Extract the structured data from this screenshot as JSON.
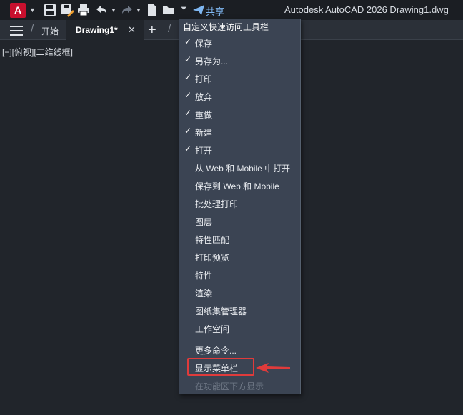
{
  "titlebar": {
    "app_letter": "A",
    "share_label": "共享",
    "title": "Autodesk AutoCAD 2026    Drawing1.dwg",
    "qat_icons": [
      "save-icon",
      "save-as-icon",
      "print-icon",
      "undo-icon",
      "redo-icon",
      "new-icon",
      "open-icon",
      "customize-dropdown-icon",
      "share-icon"
    ]
  },
  "tabs": {
    "start": "开始",
    "active": "Drawing1*",
    "close": "✕",
    "add": "+"
  },
  "viewport": {
    "label": "[−][俯视][二维线框]"
  },
  "menu": {
    "title": "自定义快速访问工具栏",
    "items": [
      {
        "label": "保存",
        "checked": true
      },
      {
        "label": "另存为...",
        "checked": true
      },
      {
        "label": "打印",
        "checked": true
      },
      {
        "label": "放弃",
        "checked": true
      },
      {
        "label": "重做",
        "checked": true
      },
      {
        "label": "新建",
        "checked": true
      },
      {
        "label": "打开",
        "checked": true
      },
      {
        "label": "从 Web 和 Mobile 中打开",
        "checked": false
      },
      {
        "label": "保存到 Web 和 Mobile",
        "checked": false
      },
      {
        "label": "批处理打印",
        "checked": false
      },
      {
        "label": "图层",
        "checked": false
      },
      {
        "label": "特性匹配",
        "checked": false
      },
      {
        "label": "打印预览",
        "checked": false
      },
      {
        "label": "特性",
        "checked": false
      },
      {
        "label": "渲染",
        "checked": false
      },
      {
        "label": "图纸集管理器",
        "checked": false
      },
      {
        "label": "工作空间",
        "checked": false
      }
    ],
    "more": "更多命令...",
    "show_menubar": "显示菜单栏",
    "show_below_ribbon": "在功能区下方显示"
  },
  "colors": {
    "accent": "#c8102e",
    "highlight": "#e03b3b",
    "share": "#7fb7f2"
  }
}
